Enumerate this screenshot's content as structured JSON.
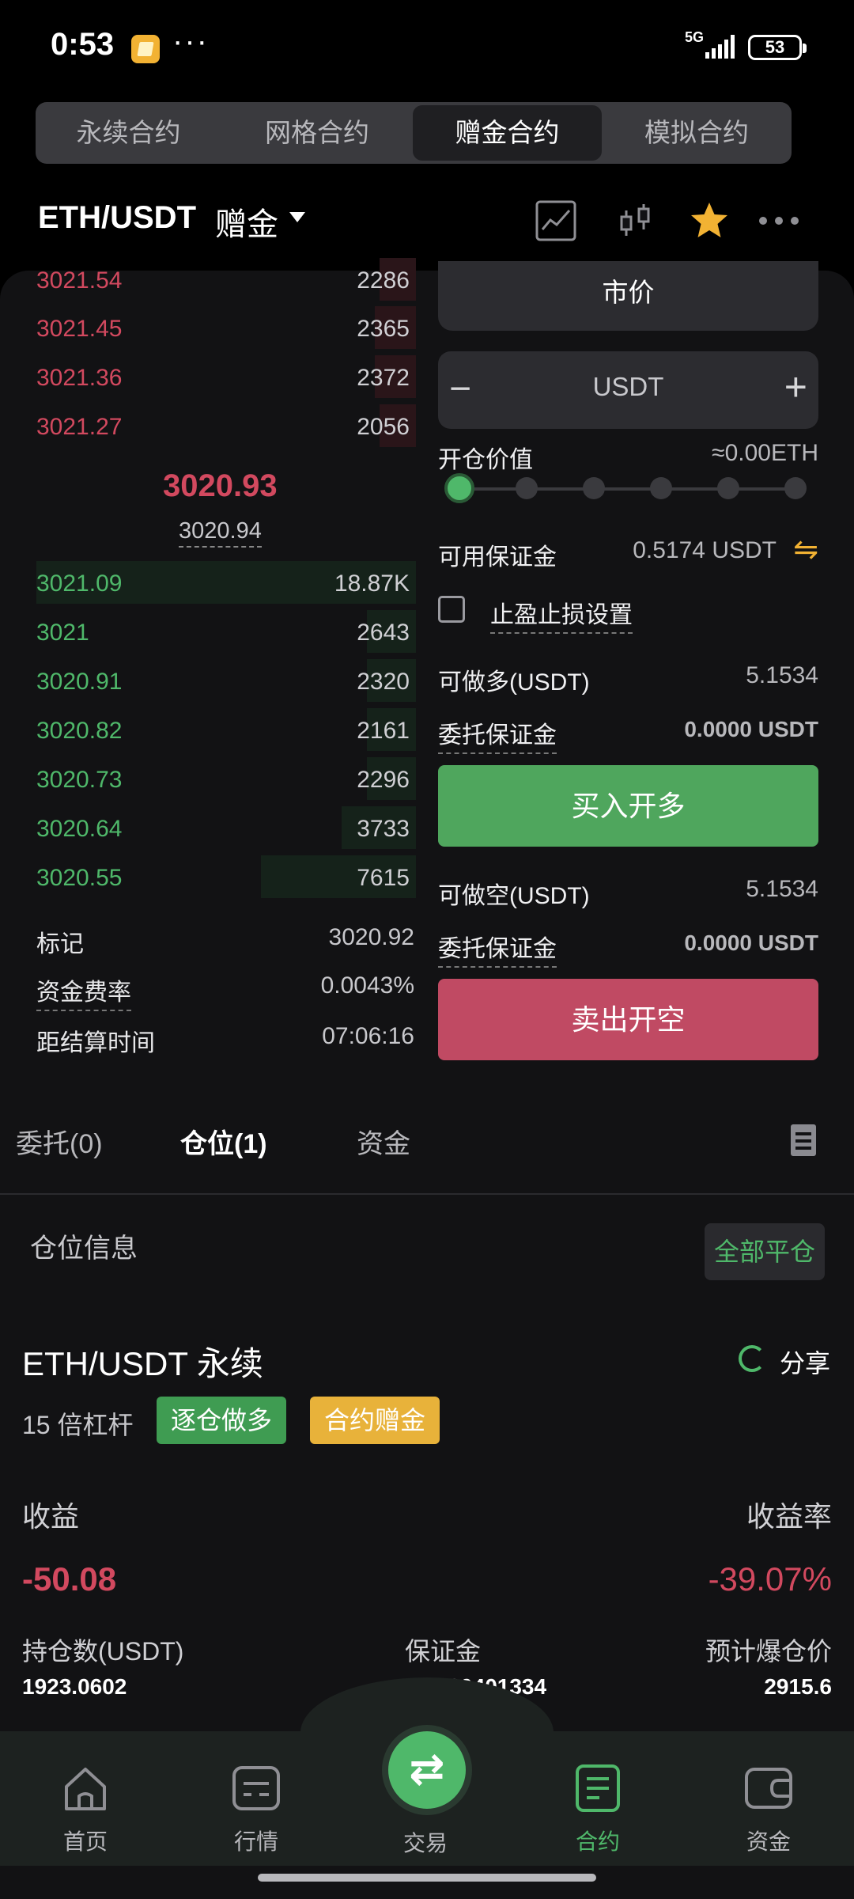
{
  "status_bar": {
    "time": "0:53",
    "dots": "···",
    "network": "5G",
    "battery": "53"
  },
  "segments": [
    "永续合约",
    "网格合约",
    "赠金合约",
    "模拟合约"
  ],
  "header": {
    "pair": "ETH/USDT",
    "sub": "赠金"
  },
  "orderbook": {
    "asks": [
      {
        "price": "3021.54",
        "qty": "2286"
      },
      {
        "price": "3021.45",
        "qty": "2365"
      },
      {
        "price": "3021.36",
        "qty": "2372"
      },
      {
        "price": "3021.27",
        "qty": "2056"
      }
    ],
    "mid_price": "3020.93",
    "index_price": "3020.94",
    "bids": [
      {
        "price": "3021.09",
        "qty": "18.87K"
      },
      {
        "price": "3021",
        "qty": "2643"
      },
      {
        "price": "3020.91",
        "qty": "2320"
      },
      {
        "price": "3020.82",
        "qty": "2161"
      },
      {
        "price": "3020.73",
        "qty": "2296"
      },
      {
        "price": "3020.64",
        "qty": "3733"
      },
      {
        "price": "3020.55",
        "qty": "7615"
      }
    ],
    "info": [
      {
        "label": "标记",
        "value": "3020.92"
      },
      {
        "label": "资金费率",
        "value": "0.0043%"
      },
      {
        "label": "距结算时间",
        "value": "07:06:16"
      }
    ]
  },
  "form": {
    "order_type": "市价",
    "minus": "−",
    "unit": "USDT",
    "plus": "+",
    "open_value_label": "开仓价值",
    "open_value": "≈0.00ETH",
    "available_label": "可用保证金",
    "available_value": "0.5174 USDT",
    "swap_icon": "⇋",
    "tpsl_label": "止盈止损设置",
    "long_label": "可做多(USDT)",
    "long_value": "5.1534",
    "margin_label": "委托保证金",
    "margin_value": "0.0000 USDT",
    "buy_label": "买入开多",
    "short_label": "可做空(USDT)",
    "short_value": "5.1534",
    "margin_label_2": "委托保证金",
    "margin_value_2": "0.0000 USDT",
    "sell_label": "卖出开空"
  },
  "tabs": {
    "orders": "委托(0)",
    "positions": "仓位(1)",
    "assets": "资金"
  },
  "position": {
    "section_title": "仓位信息",
    "close_all": "全部平仓",
    "title": "ETH/USDT 永续",
    "share": "分享",
    "leverage": "15 倍杠杆",
    "badge_mode": "逐仓做多",
    "badge_bonus": "合约赠金",
    "pnl_label": "收益",
    "pnl_rate_label": "收益率",
    "pnl": "-50.08",
    "pnl_rate": "-39.07%",
    "size_label": "持仓数(USDT)",
    "size": "1923.0602",
    "margin_label": "保证金",
    "margin": "128.20401334",
    "liq_label": "预计爆仓价",
    "liq": "2915.6"
  },
  "nav": {
    "home": "首页",
    "market": "行情",
    "trade": "交易",
    "trade_icon": "⇄",
    "futures": "合约",
    "assets": "资金"
  },
  "colors": {
    "up": "#4fb86a",
    "down": "#d2495f",
    "accent": "#f2b233"
  }
}
